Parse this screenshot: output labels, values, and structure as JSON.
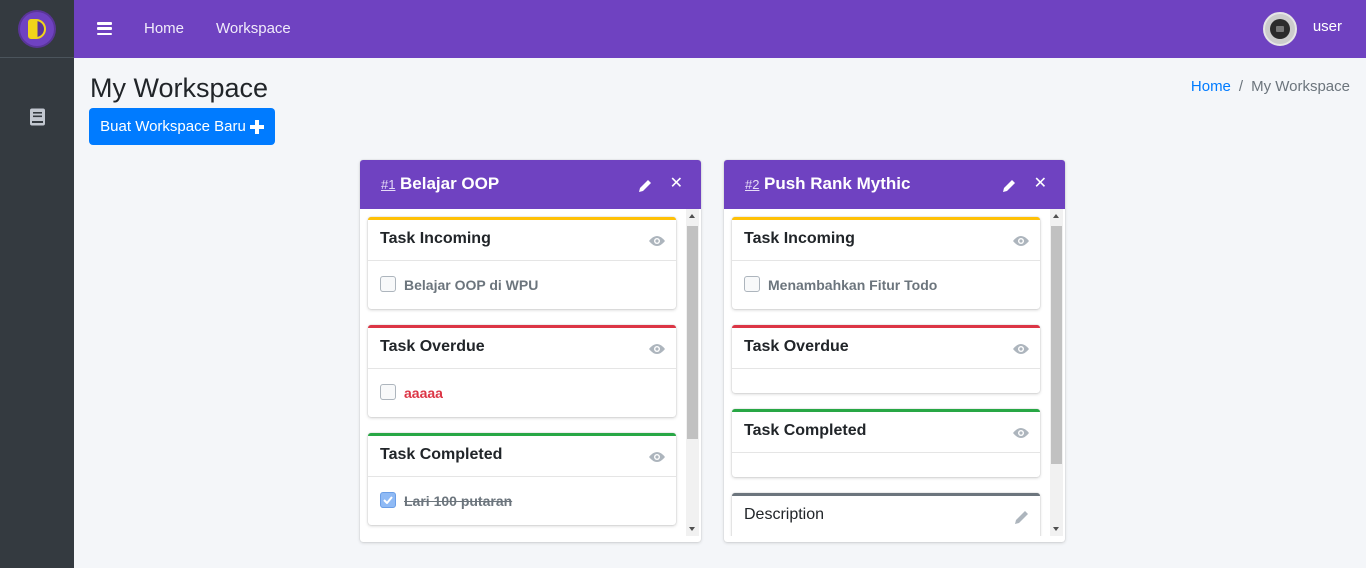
{
  "navbar": {
    "links": [
      "Home",
      "Workspace"
    ],
    "user": "user"
  },
  "content": {
    "title": "My Workspace",
    "new_button": "Buat Workspace Baru",
    "breadcrumb": [
      "Home",
      "My Workspace"
    ]
  },
  "colors": {
    "brand": "#6f42c1",
    "primary": "#007bff",
    "incoming": "#ffc107",
    "overdue": "#dc3545",
    "completed": "#28a745",
    "description": "#6c757d"
  },
  "workspaces": [
    {
      "number": "#1",
      "title": "Belajar OOP",
      "incoming": {
        "title": "Task Incoming",
        "items": [
          "Belajar OOP di WPU"
        ]
      },
      "overdue": {
        "title": "Task Overdue",
        "items": [
          "aaaaa"
        ]
      },
      "completed": {
        "title": "Task Completed",
        "items": [
          "Lari 100 putaran"
        ]
      }
    },
    {
      "number": "#2",
      "title": "Push Rank Mythic",
      "incoming": {
        "title": "Task Incoming",
        "items": [
          "Menambahkan Fitur Todo"
        ]
      },
      "overdue": {
        "title": "Task Overdue",
        "items": []
      },
      "completed": {
        "title": "Task Completed",
        "items": []
      },
      "description": {
        "title": "Description"
      }
    }
  ],
  "icons": [
    "hamburger-icon",
    "book-icon",
    "eye-icon",
    "pencil-icon",
    "close-icon",
    "plus-icon",
    "check-icon"
  ]
}
